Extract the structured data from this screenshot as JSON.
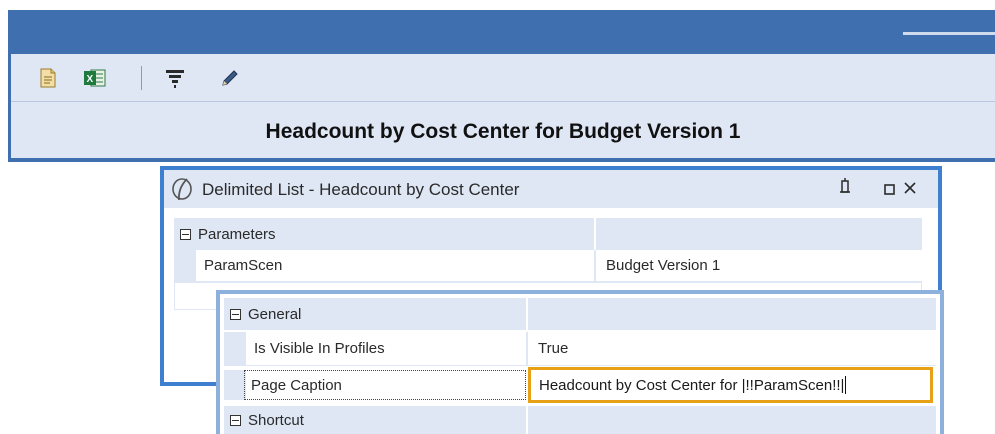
{
  "main_window": {
    "report_title": "Headcount by Cost Center for Budget Version 1",
    "toolbar": {
      "icons": [
        "document-icon",
        "excel-icon",
        "filter-icon",
        "pencil-icon"
      ]
    }
  },
  "dialog": {
    "title": "Delimited List - Headcount by Cost Center",
    "parameters": {
      "category": "Parameters",
      "rows": [
        {
          "name": "ParamScen",
          "value": "Budget Version 1"
        }
      ]
    }
  },
  "properties": {
    "general_category": "General",
    "rows": [
      {
        "name": "Is Visible In Profiles",
        "value": "True"
      },
      {
        "name": "Page Caption",
        "value": "Headcount by Cost Center for |!!ParamScen!!|"
      }
    ],
    "shortcut_category": "Shortcut"
  },
  "colors": {
    "window_blue": "#3f6fae",
    "dialog_blue": "#3f7fcf",
    "panel_bg": "#dfe7f5",
    "focus_border": "#e8a116"
  }
}
